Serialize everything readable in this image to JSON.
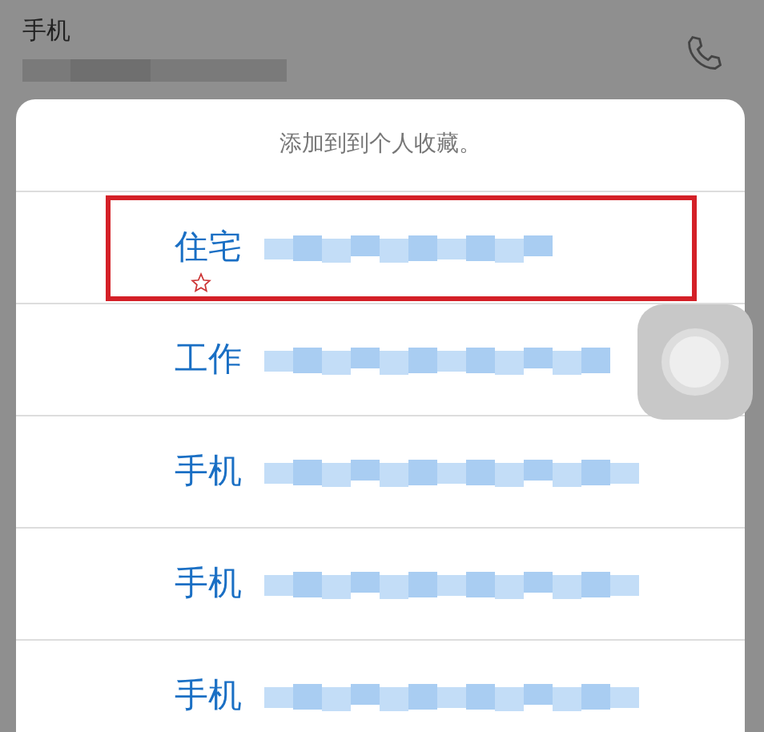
{
  "contact": {
    "label": "手机"
  },
  "sheet": {
    "title": "添加到到个人收藏。",
    "rows": [
      {
        "label": "住宅",
        "highlighted": true,
        "starred": true
      },
      {
        "label": "工作",
        "highlighted": false,
        "starred": false
      },
      {
        "label": "手机",
        "highlighted": false,
        "starred": false
      },
      {
        "label": "手机",
        "highlighted": false,
        "starred": false
      },
      {
        "label": "手机",
        "highlighted": false,
        "starred": false
      }
    ]
  }
}
